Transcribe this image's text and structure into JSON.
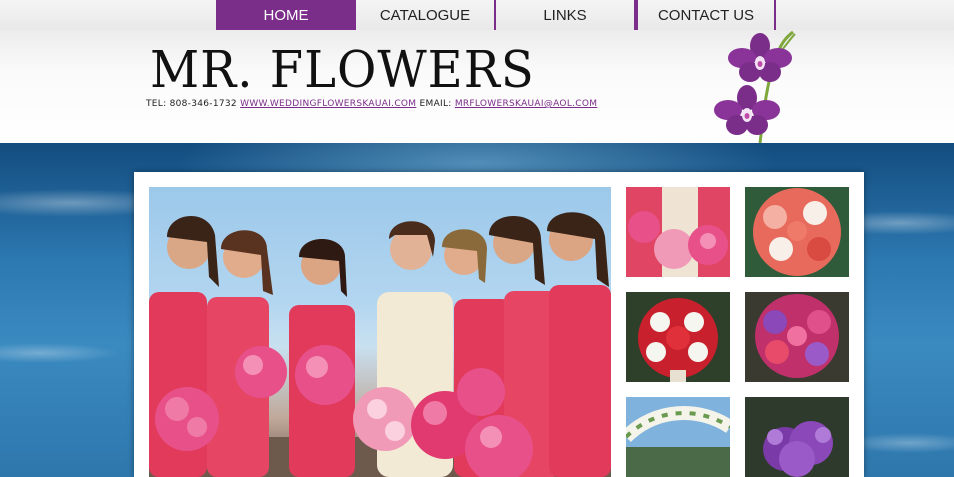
{
  "nav": {
    "items": [
      {
        "label": "HOME",
        "active": true
      },
      {
        "label": "CATALOGUE",
        "active": false
      },
      {
        "label": "LINKS",
        "active": false
      },
      {
        "label": "CONTACT US",
        "active": false
      }
    ]
  },
  "header": {
    "logo": "MR. FLOWERS",
    "tel_label": "TEL: 808-346-1732",
    "website": "WWW.WEDDINGFLOWERSKAUAI.COM",
    "email_label": "EMAIL:",
    "email": "MRFLOWERSKAUAI@AOL.COM"
  },
  "colors": {
    "accent": "#7b2d8a",
    "dress_pink": "#e13a5a",
    "ocean": "#2c78b0"
  },
  "gallery": {
    "main_image": "bridal-party-photo",
    "thumbnails": [
      "bridesmaid-bouquets-thumb",
      "coral-lily-bouquet-thumb",
      "red-white-bouquet-thumb",
      "purple-pink-bouquet-thumb",
      "orchid-arch-thumb",
      "purple-orchid-thumb"
    ]
  }
}
